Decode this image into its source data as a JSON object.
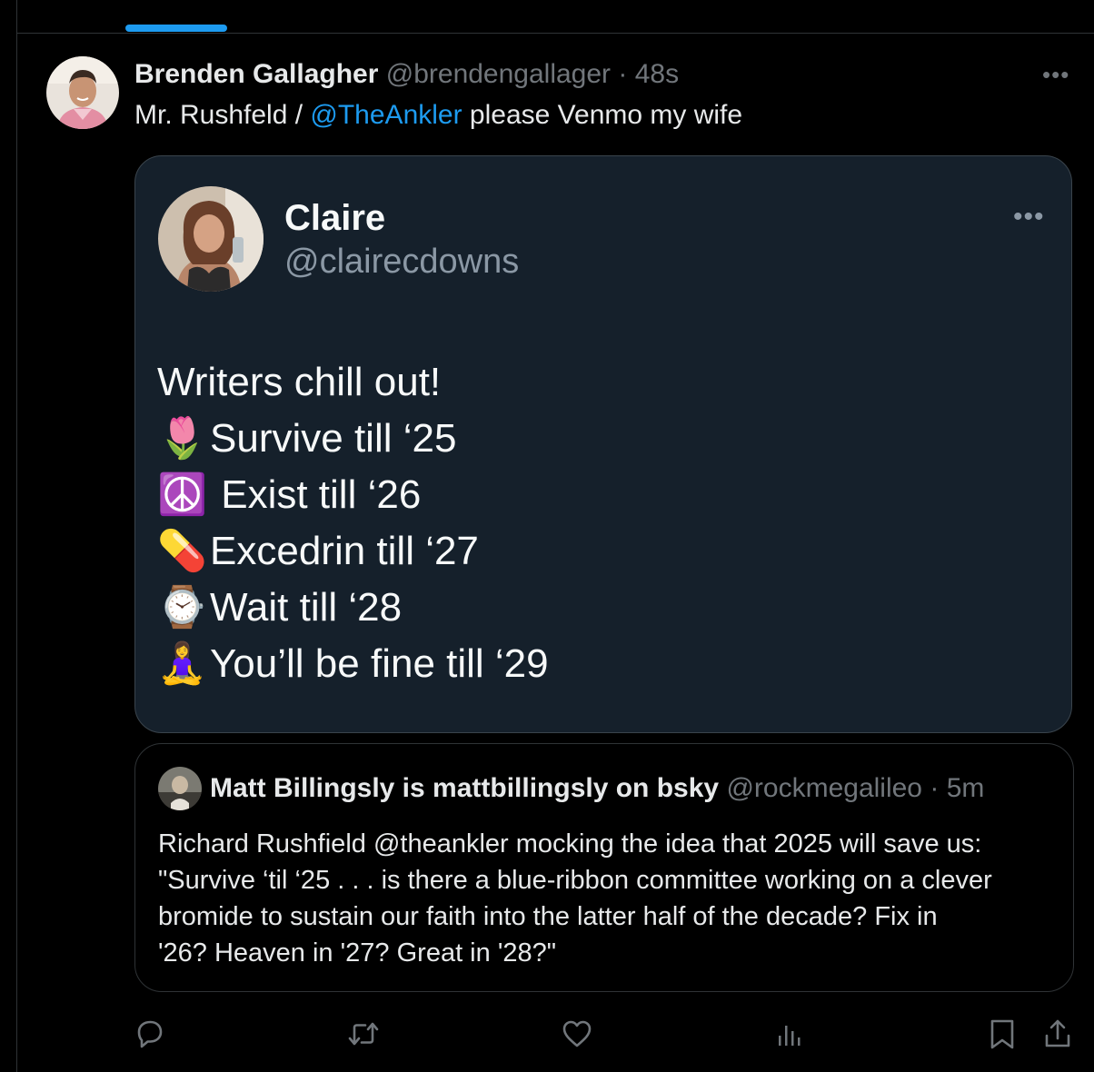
{
  "tweet": {
    "author_name": "Brenden Gallagher",
    "author_handle": "@brendengallager",
    "separator": "·",
    "time": "48s",
    "text_before": "Mr. Rushfeld / ",
    "mention": "@TheAnkler",
    "text_after": " please Venmo my wife"
  },
  "embedded_post": {
    "name": "Claire",
    "handle": "@clairecdowns",
    "lines": [
      {
        "emoji": "",
        "text": "Writers chill out!"
      },
      {
        "emoji": "🌷",
        "text": "Survive till ‘25"
      },
      {
        "emoji": "☮️",
        "text": " Exist till ‘26"
      },
      {
        "emoji": "💊",
        "text": "Excedrin till ‘27"
      },
      {
        "emoji": "⌚",
        "text": "Wait till ‘28"
      },
      {
        "emoji": "🧘‍♀️",
        "text": "You’ll be fine till ‘29"
      }
    ]
  },
  "quoted_tweet": {
    "author_name": "Matt Billingsly is mattbillingsly on bsky",
    "author_handle": "@rockmegalileo",
    "separator": "·",
    "time": "5m",
    "text_lines": [
      "Richard Rushfield @theankler mocking the idea that 2025 will save us:",
      "\"Survive ‘til ‘25 . . . is there a blue-ribbon committee working on a clever",
      "bromide to sustain our faith into the latter half of the decade? Fix in",
      "'26? Heaven in '27? Great in '28?\""
    ]
  },
  "actions": [
    "reply-icon",
    "retweet-icon",
    "like-icon",
    "views-icon",
    "bookmark-icon",
    "share-icon"
  ],
  "colors": {
    "accent": "#1d9bf0",
    "muted": "#71767b",
    "background": "#000000",
    "card_background": "#15202b"
  }
}
